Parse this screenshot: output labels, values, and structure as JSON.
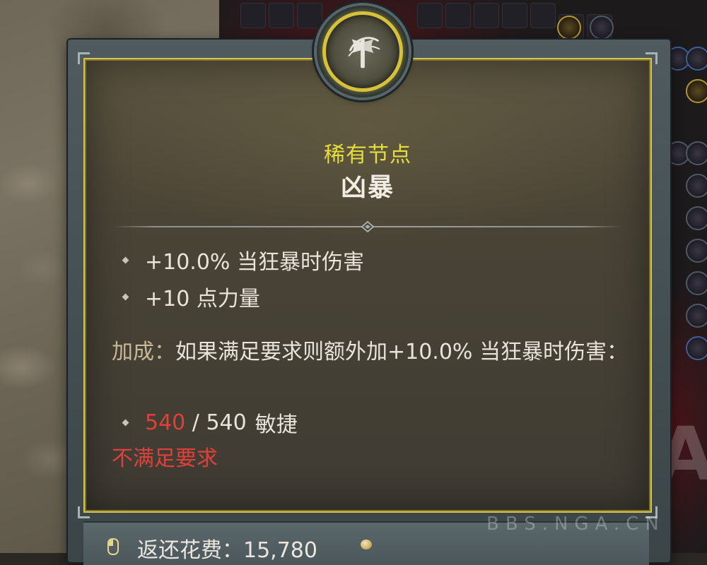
{
  "tooltip": {
    "rarity_label": "稀有节点",
    "node_name": "凶暴",
    "stats": [
      "+10.0% 当狂暴时伤害",
      "+10 点力量"
    ],
    "bonus_label": "加成：",
    "bonus_text": "如果满足要求则额外加+10.0% 当狂暴时伤害：",
    "requirement": {
      "current": "540",
      "separator": " / ",
      "total": "540",
      "attribute": "敏捷"
    },
    "unmet_text": "不满足要求",
    "icon": "axe-icon"
  },
  "refund": {
    "label": "返还花费：",
    "amount": "15,780",
    "icons": [
      "mouse-icon",
      "gold-icon"
    ]
  },
  "watermark": {
    "logo": "NGA",
    "site": "BBS.NGA.CN"
  },
  "colors": {
    "rarity": "#e6de3e",
    "frame_gold": "#d6c64e",
    "unmet_red": "#e0403a",
    "bonus_label": "#c9b894"
  }
}
